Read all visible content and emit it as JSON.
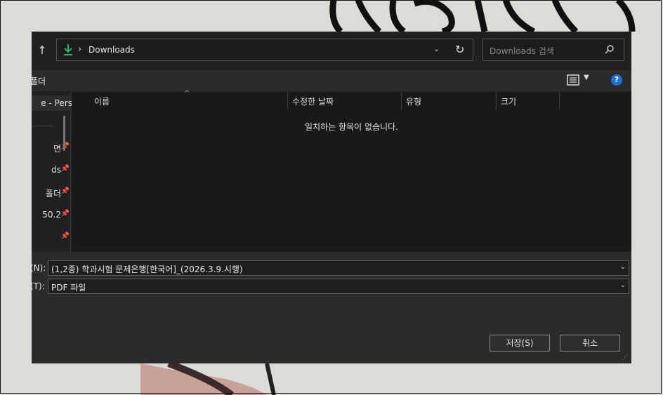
{
  "address_bar": {
    "path": "Downloads"
  },
  "search": {
    "placeholder": "Downloads 검색"
  },
  "toolbar": {
    "new_folder_label": "폴더"
  },
  "nav_pane": {
    "items": [
      {
        "label": "e - Pers",
        "pinned": false
      },
      {
        "label": "면",
        "pinned": true
      },
      {
        "label": "ds",
        "pinned": true
      },
      {
        "label": "폴더",
        "pinned": true
      },
      {
        "label": "50.2",
        "pinned": true
      },
      {
        "label": "",
        "pinned": true
      }
    ]
  },
  "file_list": {
    "columns": [
      "이름",
      "수정한 날짜",
      "유형",
      "크기"
    ],
    "empty_message": "일치하는 항목이 없습니다."
  },
  "save_form": {
    "filename_label": "(N):",
    "filename_value": "(1,2종) 학과시험 문제은행[한국어]_(2026.3.9.시행)",
    "filetype_label": "(T):",
    "filetype_value": "PDF 파일"
  },
  "buttons": {
    "save": "저장(S)",
    "cancel": "취소"
  },
  "colors": {
    "dialog_bg": "#202020",
    "accent": "#1e6fd9",
    "download_icon": "#2fb16a"
  }
}
